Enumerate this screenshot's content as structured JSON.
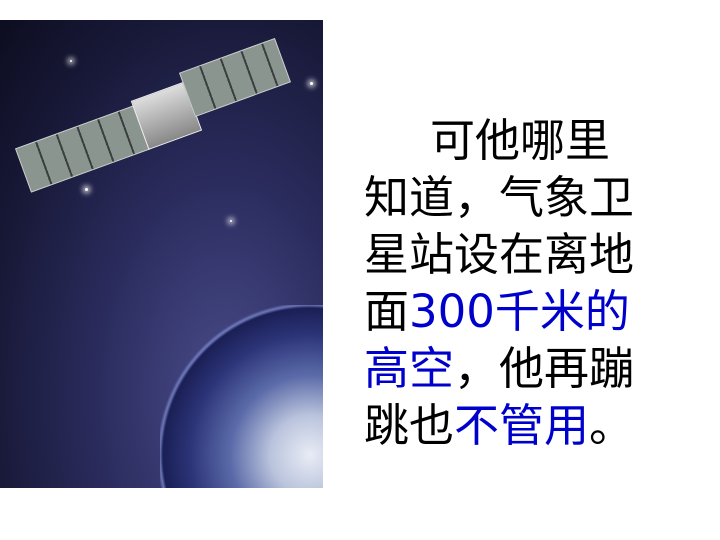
{
  "image": {
    "description_icon": "satellite-earth-photo"
  },
  "text": {
    "line1": "可他哪里",
    "line2": "知道，气象卫",
    "line3": "星站设在离地",
    "line4a": "面",
    "line4b": "300千米的",
    "line5a": "高空",
    "line5b": "，他再蹦",
    "line6a": "跳也",
    "line6b": "不管用",
    "line6c": "。"
  },
  "colors": {
    "highlight": "#0000cc",
    "text": "#000000"
  }
}
